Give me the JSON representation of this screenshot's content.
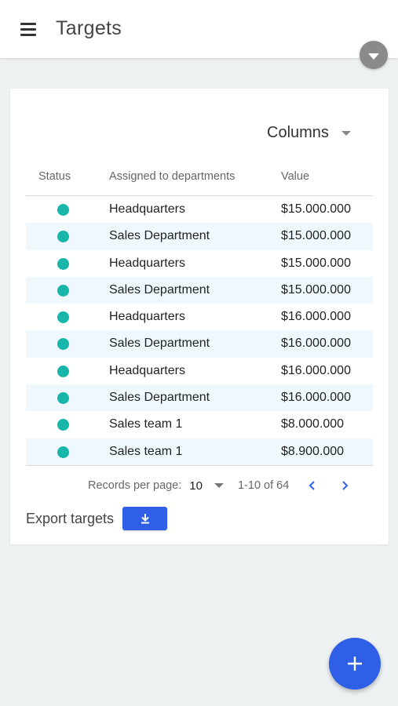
{
  "header": {
    "title": "Targets",
    "menu_icon": "hamburger-menu-icon",
    "account_icon": "chevron-down-icon"
  },
  "toolbar": {
    "columns_label": "Columns"
  },
  "table": {
    "columns": [
      "Status",
      "Assigned to departments",
      "Value"
    ],
    "rows": [
      {
        "status": "active",
        "department": "Headquarters",
        "value": "$15.000.000"
      },
      {
        "status": "active",
        "department": "Sales Department",
        "value": "$15.000.000"
      },
      {
        "status": "active",
        "department": "Headquarters",
        "value": "$15.000.000"
      },
      {
        "status": "active",
        "department": "Sales Department",
        "value": "$15.000.000"
      },
      {
        "status": "active",
        "department": "Headquarters",
        "value": "$16.000.000"
      },
      {
        "status": "active",
        "department": "Sales Department",
        "value": "$16.000.000"
      },
      {
        "status": "active",
        "department": "Headquarters",
        "value": "$16.000.000"
      },
      {
        "status": "active",
        "department": "Sales Department",
        "value": "$16.000.000"
      },
      {
        "status": "active",
        "department": "Sales team 1",
        "value": "$8.000.000"
      },
      {
        "status": "active",
        "department": "Sales team 1",
        "value": "$8.900.000"
      }
    ]
  },
  "pagination": {
    "records_per_page_label": "Records per page:",
    "records_per_page_value": "10",
    "range_text": "1-10 of 64"
  },
  "export": {
    "label": "Export targets",
    "icon": "download-icon"
  },
  "fab": {
    "icon": "plus-icon"
  },
  "colors": {
    "accent": "#2f5fe6",
    "status_active": "#17b5aa",
    "row_alt": "#eef8fd",
    "background": "#eef1f2"
  }
}
